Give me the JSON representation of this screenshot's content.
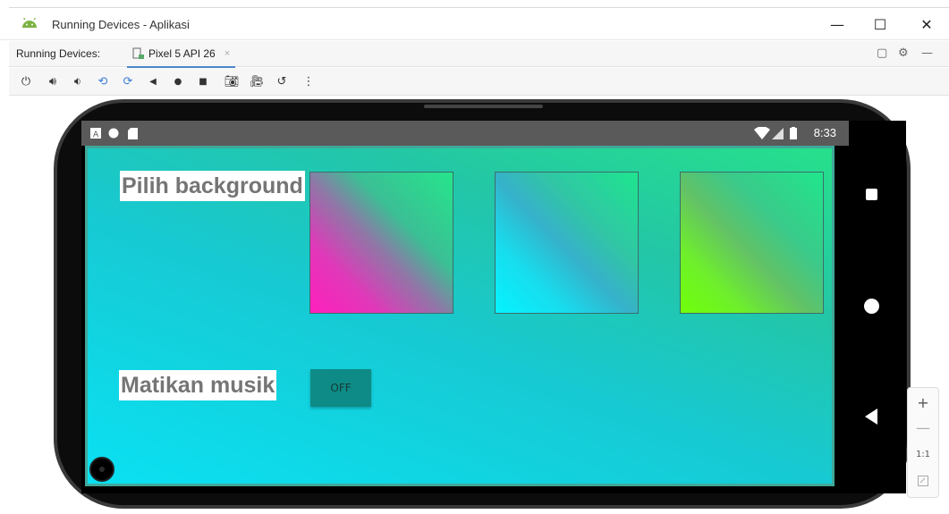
{
  "window": {
    "title": "Running Devices - Aplikasi",
    "minimize_glyph": "—",
    "maximize_glyph": "☐",
    "close_glyph": "✕"
  },
  "running_devices": {
    "label": "Running Devices:",
    "tab_label": "Pixel 5 API 26",
    "tab_close": "×"
  },
  "toolbar": {
    "icons": [
      "power-icon",
      "volume-up-icon",
      "volume-down-icon",
      "rotate-left-icon",
      "rotate-right-icon",
      "back-icon",
      "home-icon",
      "overview-icon",
      "screenshot-icon",
      "screen-record-icon",
      "snapshot-icon",
      "more-icon"
    ]
  },
  "device": {
    "status_time": "8:33",
    "status_left_icons": [
      "a-notification-icon",
      "circle-notification-icon",
      "sd-card-icon"
    ],
    "status_right_icons": [
      "wifi-icon",
      "cell-signal-icon",
      "battery-icon"
    ]
  },
  "app": {
    "choose_background_label": "Pilih background",
    "mute_music_label": "Matikan musik",
    "music_toggle_label": "OFF",
    "backgrounds": [
      {
        "name": "pink-green",
        "colors": [
          "#ff1fbd",
          "#25e58b"
        ]
      },
      {
        "name": "cyan-green",
        "colors": [
          "#05f3ff",
          "#1ee58e"
        ]
      },
      {
        "name": "lime-green",
        "colors": [
          "#70ff0a",
          "#20e68c"
        ]
      }
    ],
    "accent_color": "#0e8b86"
  },
  "zoom_controls": {
    "zoom_in": "+",
    "zoom_out": "—",
    "actual_size": "1:1"
  }
}
